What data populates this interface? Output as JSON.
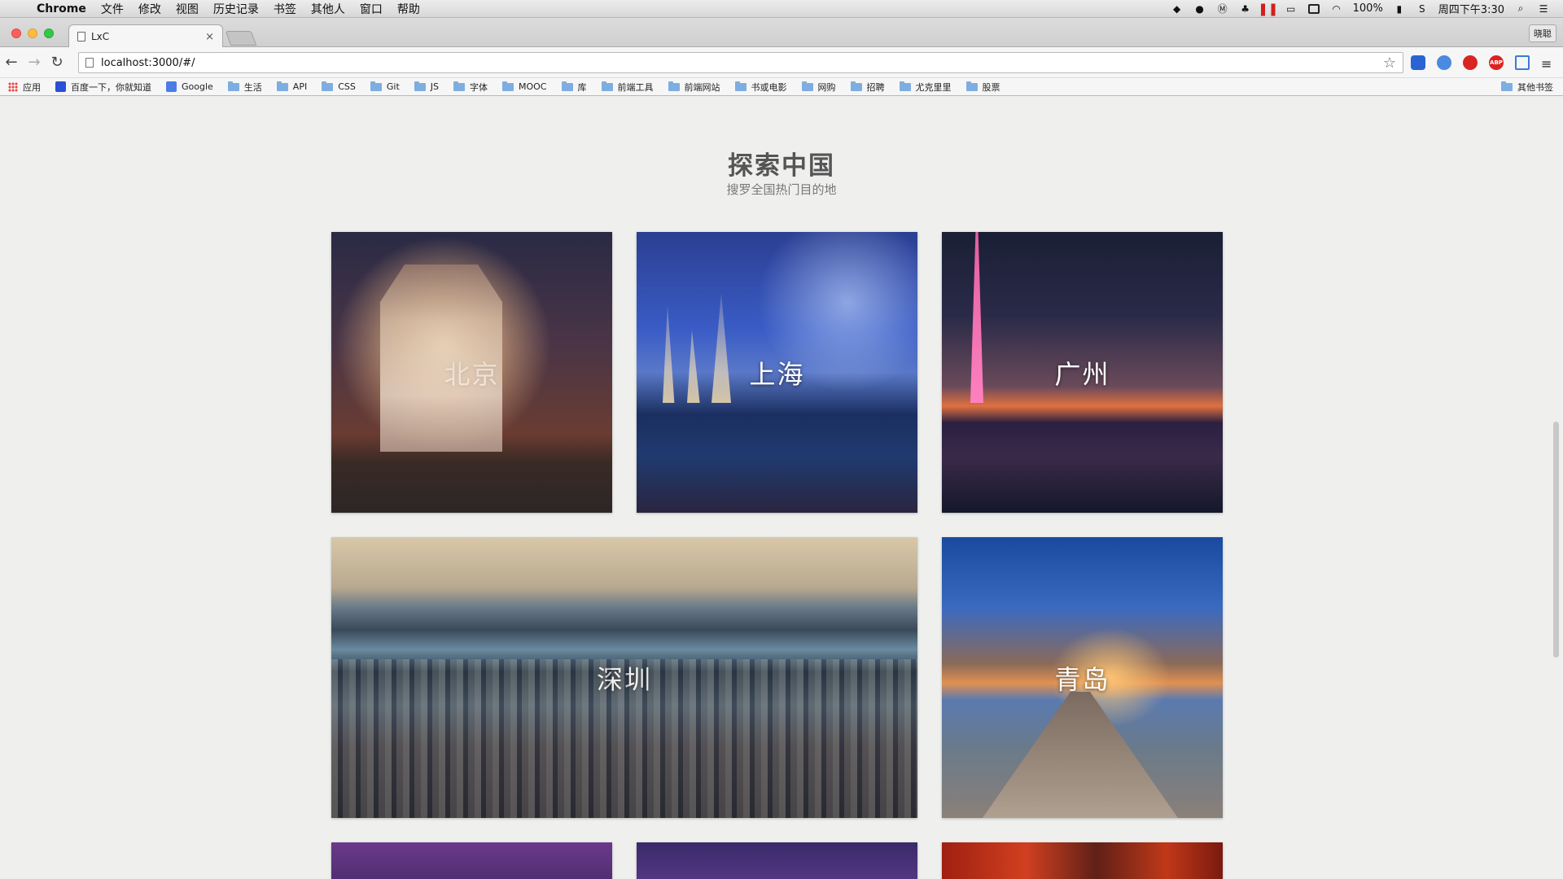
{
  "menubar": {
    "app_name": "Chrome",
    "items": [
      "文件",
      "修改",
      "视图",
      "历史记录",
      "书签",
      "其他人",
      "窗口",
      "帮助"
    ],
    "battery": "100%",
    "clock": "周四下午3:30"
  },
  "browser": {
    "tab_title": "LxC",
    "tab_close": "×",
    "profile_name": "晓聪",
    "url": "localhost:3000/#/",
    "bookmarks": {
      "apps": "应用",
      "baidu": "百度一下，你就知道",
      "google": "Google",
      "folders": [
        "生活",
        "API",
        "CSS",
        "Git",
        "JS",
        "字体",
        "MOOC",
        "库",
        "前端工具",
        "前端网站",
        "书或电影",
        "网购",
        "招聘",
        "尤克里里",
        "股票"
      ],
      "other": "其他书签"
    }
  },
  "page": {
    "title": "探索中国",
    "subtitle": "搜罗全国热门目的地",
    "cities": [
      "北京",
      "上海",
      "广州",
      "深圳",
      "青岛"
    ]
  },
  "colors": {
    "page_background": "#eff0ee",
    "title": "#555555",
    "city_label": "#ffffff"
  },
  "icons": [
    "apple-icon",
    "qq-icon",
    "bell-icon",
    "wechat-icon",
    "wifi-icon",
    "battery-icon",
    "search-icon",
    "list-icon",
    "star-icon",
    "abp-icon",
    "hamburger-menu-icon",
    "folder-icon"
  ]
}
